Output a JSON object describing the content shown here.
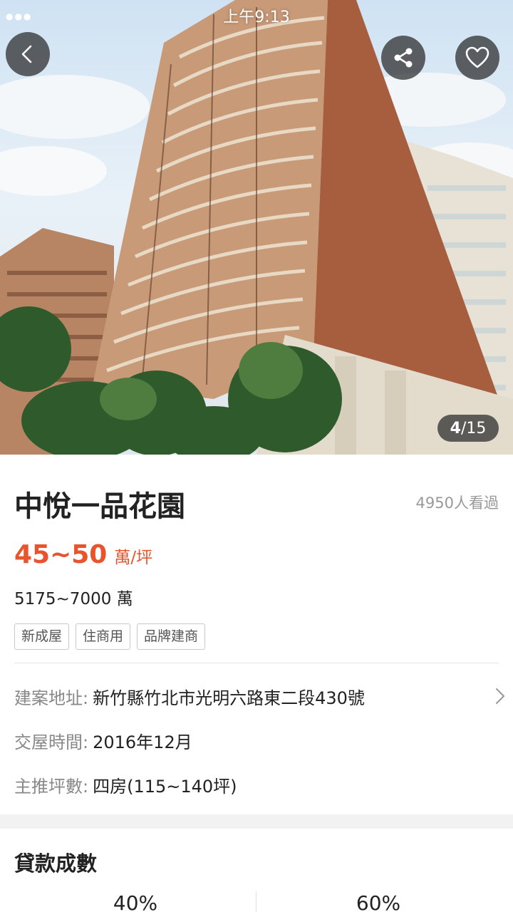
{
  "status_bar": {
    "time": "上午9:13"
  },
  "hero": {
    "photo_subject": "high-rise residential tower",
    "icons": {
      "back": "chevron-left-icon",
      "share": "share-icon",
      "favorite": "heart-icon"
    },
    "counter": {
      "current": "4",
      "separator": "/",
      "total": "15"
    }
  },
  "listing": {
    "title": "中悅一品花園",
    "views": "4950人看過",
    "price_range": "45~50",
    "price_unit": "萬/坪",
    "total_price": "5175~7000 萬",
    "tags": [
      "新成屋",
      "住商用",
      "品牌建商"
    ],
    "details": {
      "address_label": "建案地址:",
      "address_value": "新竹縣竹北市光明六路東二段430號",
      "delivery_label": "交屋時間:",
      "delivery_value": "2016年12月",
      "size_label": "主推坪數:",
      "size_value": "四房(115~140坪)"
    }
  },
  "loan": {
    "title": "貸款成數",
    "options": [
      "40%",
      "60%"
    ]
  },
  "colors": {
    "accent": "#e8542b",
    "muted": "#888888",
    "overlay": "#282828"
  }
}
